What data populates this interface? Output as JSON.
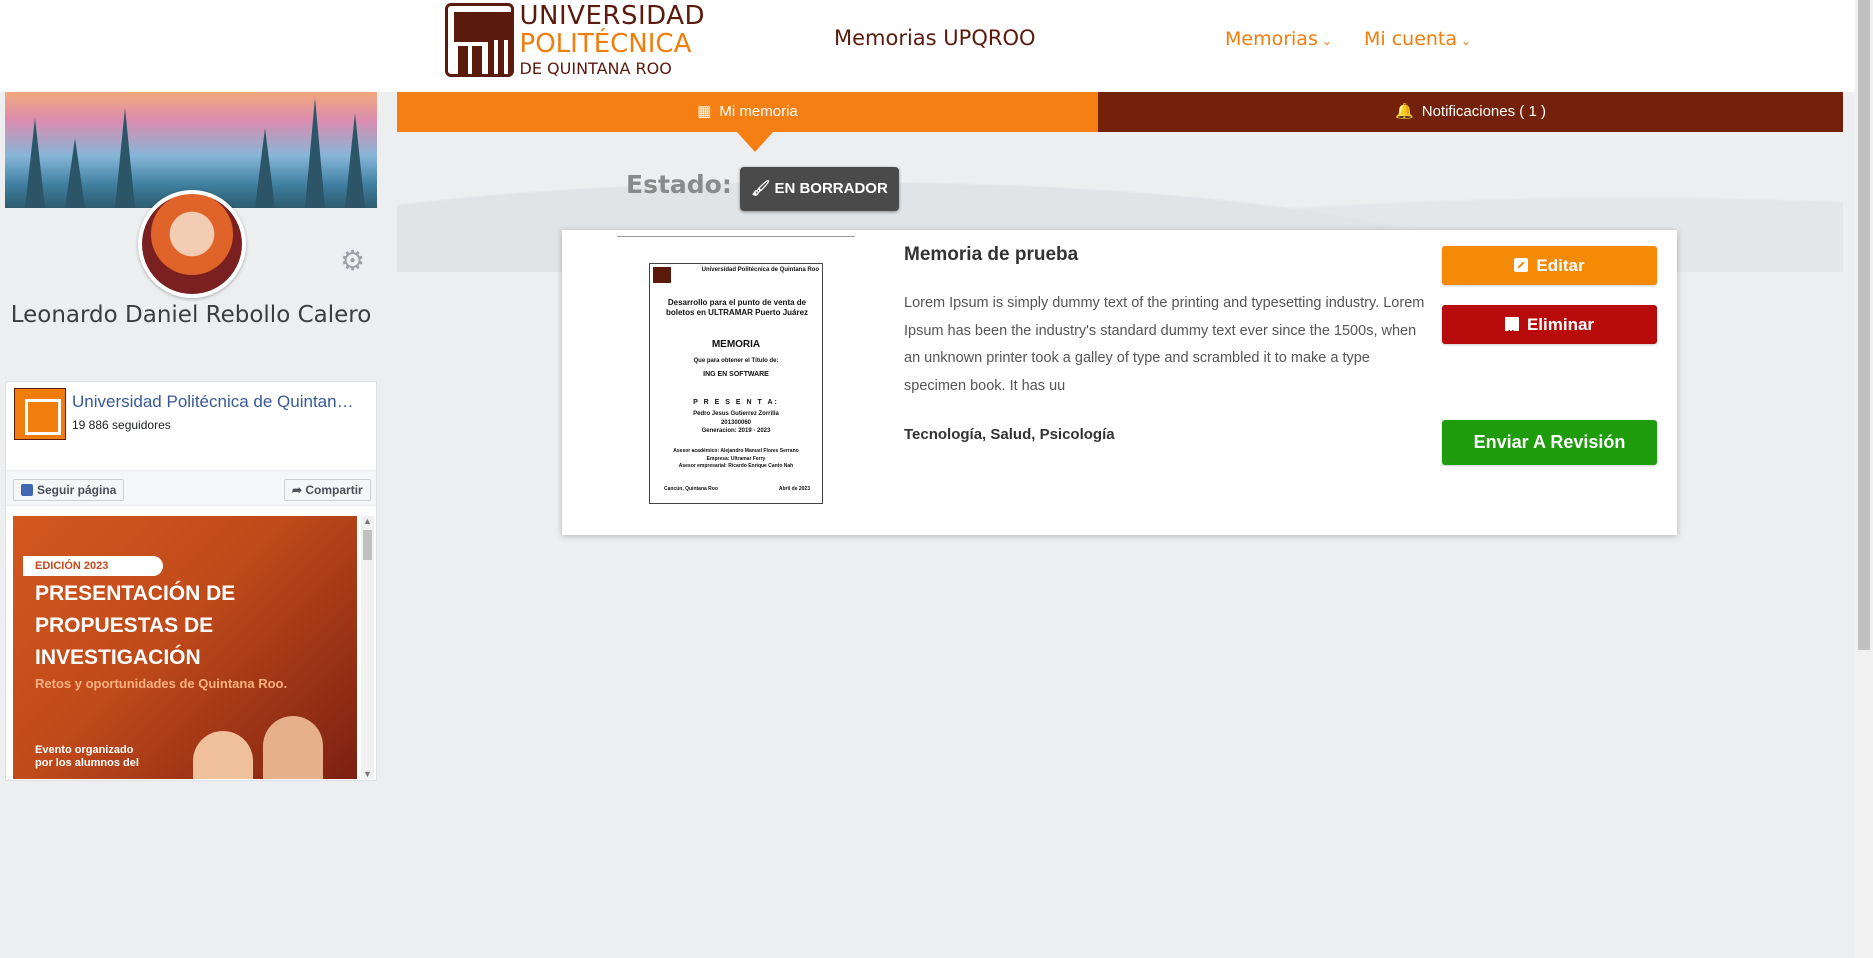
{
  "header": {
    "logo": {
      "line1": "UNIVERSIDAD",
      "line2": "POLITÉCNICA",
      "line3": "DE QUINTANA ROO"
    },
    "site_title": "Memorias UPQROO",
    "nav": {
      "memorias": "Memorias",
      "mi_cuenta": "Mi cuenta"
    }
  },
  "sidebar": {
    "user_name": "Leonardo Daniel Rebollo Calero",
    "facebook": {
      "page_name": "Universidad Politécnica de Quintana Roo",
      "followers": "19 886 seguidores",
      "follow_label": "Seguir página",
      "share_label": "Compartir",
      "post": {
        "badge": "EDICIÓN 2023",
        "headline": "PRESENTACIÓN DE PROPUESTAS DE INVESTIGACIÓN",
        "subtitle": "Retos y oportunidades de Quintana Roo.",
        "event_text": "Evento organizado por los alumnos del"
      }
    }
  },
  "tabs": {
    "mi_memoria": "Mi memoria",
    "notificaciones": "Notificaciones ( 1 )"
  },
  "state": {
    "label": "Estado:",
    "value": "EN BORRADOR"
  },
  "memory_card": {
    "title": "Memoria de prueba",
    "description": "Lorem Ipsum is simply dummy text of the printing and typesetting industry. Lorem Ipsum has been the industry's standard dummy text ever since the 1500s, when an unknown printer took a galley of type and scrambled it to make a type specimen book. It has uu",
    "tags": "Tecnología, Salud, Psicología",
    "buttons": {
      "edit": "Editar",
      "delete": "Eliminar",
      "send": "Enviar A Revisión"
    },
    "document_preview": {
      "header": "Universidad Politécnica de Quintana Roo",
      "title": "Desarrollo para el punto de venta de boletos en ULTRAMAR Puerto Juárez",
      "memoria": "MEMORIA",
      "que_para": "Que para obtener el Título de:",
      "degree": "ING EN SOFTWARE",
      "presenta": "P R E S E N T A:",
      "author": "Pedro Jesus Gutierrez Zorrilla",
      "id": "201300060",
      "generation": "Generacion: 2019 - 2023",
      "advisor_academic": "Asesor académico: Alejandro Manuel Flores Serrano",
      "company": "Empresa: Ultramar Ferry",
      "advisor_business": "Asesor empresarial: Ricardo Enrique Canto Nah",
      "place": "Cancún, Quintana Roo",
      "date": "Abril de 2023"
    }
  }
}
